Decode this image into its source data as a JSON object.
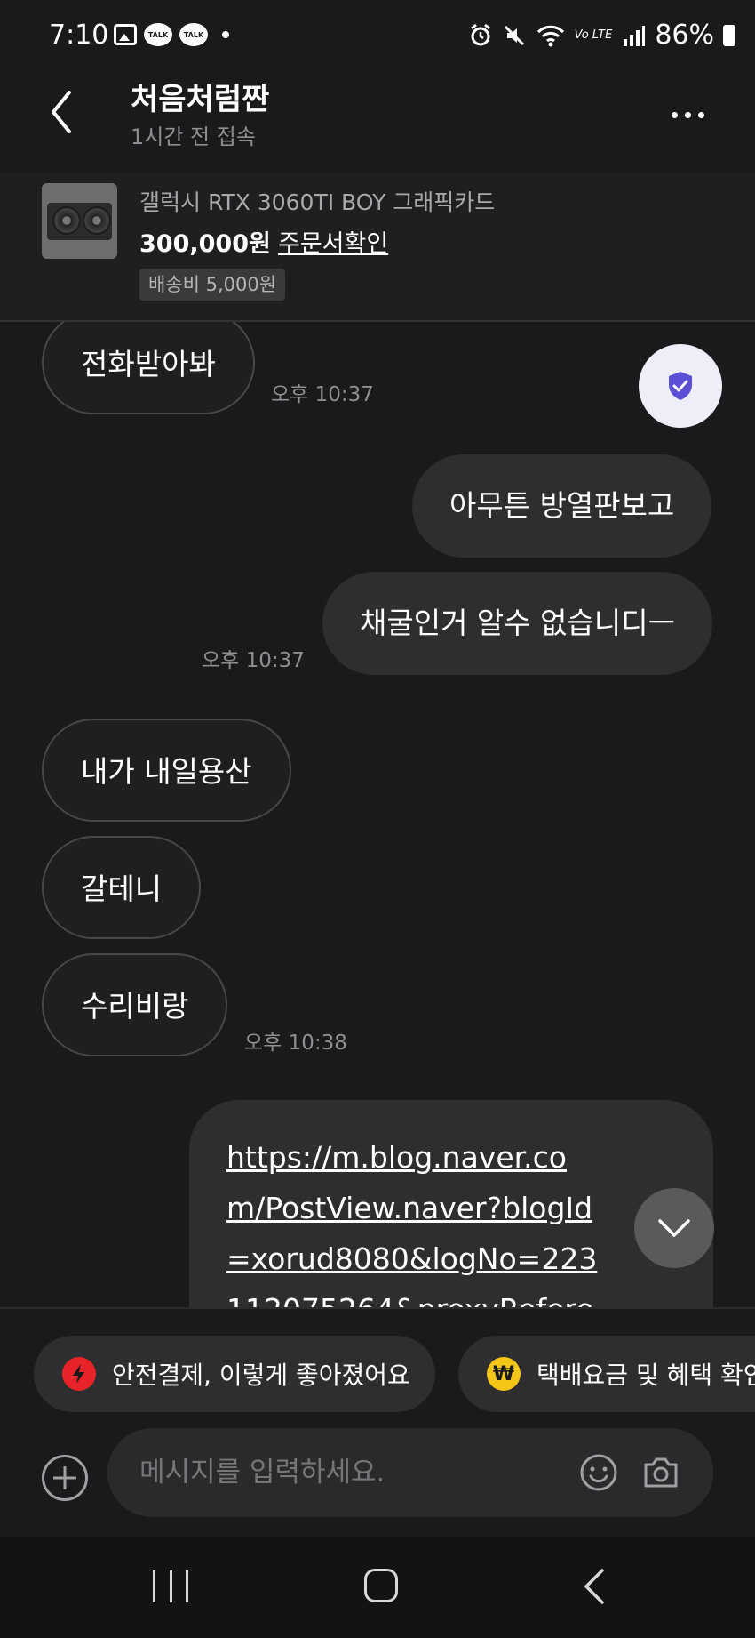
{
  "status_bar": {
    "time": "7:10",
    "talk_badge_1": "TALK",
    "talk_badge_2": "TALK",
    "volte_label": "Vo LTE",
    "battery": "86%"
  },
  "header": {
    "title": "처음처럼짠",
    "subtitle": "1시간 전 접속"
  },
  "product": {
    "name": "갤럭시 RTX 3060TI BOY 그래픽카드",
    "price": "300,000원",
    "order_link": "주문서확인",
    "shipping": "배송비 5,000원"
  },
  "messages": [
    {
      "direction": "in",
      "text": "전화받아봐"
    },
    {
      "direction": "in",
      "time": "오후 10:37"
    },
    {
      "direction": "out",
      "text": "아무튼 방열판보고"
    },
    {
      "direction": "out",
      "text": "채굴인거 알수 없습니디ㅡ"
    },
    {
      "direction": "out",
      "time": "오후 10:37"
    },
    {
      "direction": "in",
      "text": "내가 내일용산"
    },
    {
      "direction": "in",
      "text": "갈테니"
    },
    {
      "direction": "in",
      "text": "수리비랑"
    },
    {
      "direction": "in",
      "time": "오후 10:38"
    },
    {
      "direction": "out",
      "text": "https://m.blog.naver.com/PostView.naver?blogId=xorud8080&logNo=223112075264&proxyReferer="
    }
  ],
  "chips": [
    {
      "icon": "lightning-icon",
      "label": "안전결제, 이렇게 좋아졌어요",
      "color": "#e8242a"
    },
    {
      "icon": "won-icon",
      "label": "택배요금 및 혜택 확인",
      "color": "#f5c518"
    }
  ],
  "composer": {
    "placeholder": "메시지를 입력하세요."
  },
  "colors": {
    "background": "#1a1a1c",
    "incoming_bubble_border": "#48484a",
    "outgoing_bubble": "#2e2e30",
    "shield_accent": "#5b4fd6"
  }
}
